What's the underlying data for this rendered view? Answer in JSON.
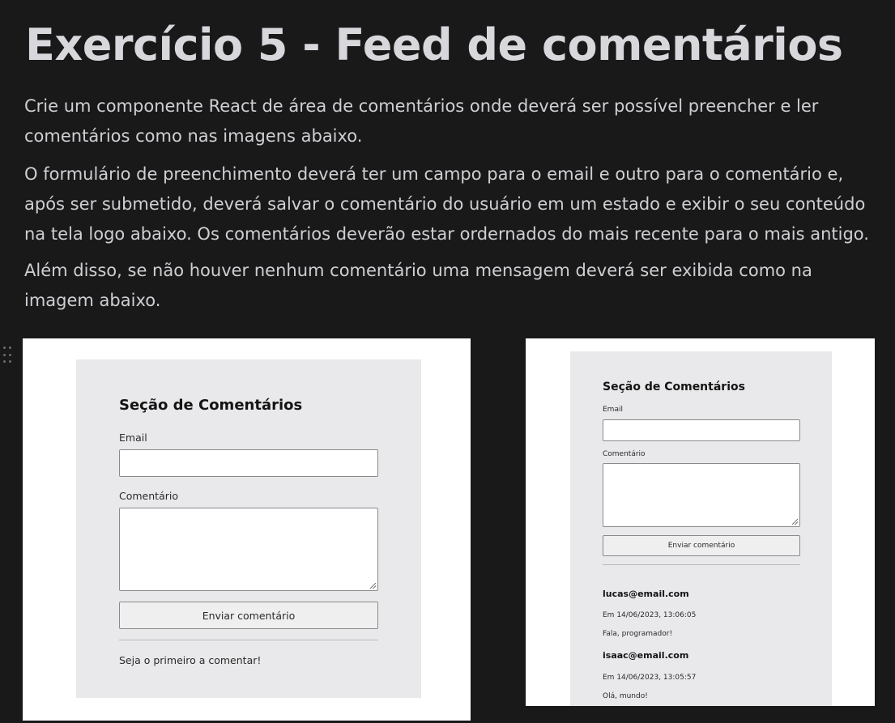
{
  "title": "Exercício 5 - Feed de comentários",
  "paragraphs": [
    "Crie um componente React de área de comentários onde deverá ser possível preencher e ler comentários como nas imagens abaixo.",
    "O formulário de preenchimento deverá ter um campo para o email e outro para o comentário e, após ser submetido, deverá salvar o comentário do usuário em um estado e exibir o seu conteúdo na tela logo abaixo. Os comentários deverão estar ordernados do mais recente para o mais antigo.",
    "Além disso, se não houver nenhum comentário uma mensagem deverá ser exibida como na imagem abaixo."
  ],
  "example_empty": {
    "section_title": "Seção de Comentários",
    "email_label": "Email",
    "comment_label": "Comentário",
    "submit_label": "Enviar comentário",
    "empty_message": "Seja o primeiro a comentar!"
  },
  "example_filled": {
    "section_title": "Seção de Comentários",
    "email_label": "Email",
    "comment_label": "Comentário",
    "submit_label": "Enviar comentário",
    "comments": [
      {
        "email": "lucas@email.com",
        "date": "Em 14/06/2023, 13:06:05",
        "text": "Fala, programador!"
      },
      {
        "email": "isaac@email.com",
        "date": "Em 14/06/2023, 13:05:57",
        "text": "Olá, mundo!"
      }
    ]
  }
}
